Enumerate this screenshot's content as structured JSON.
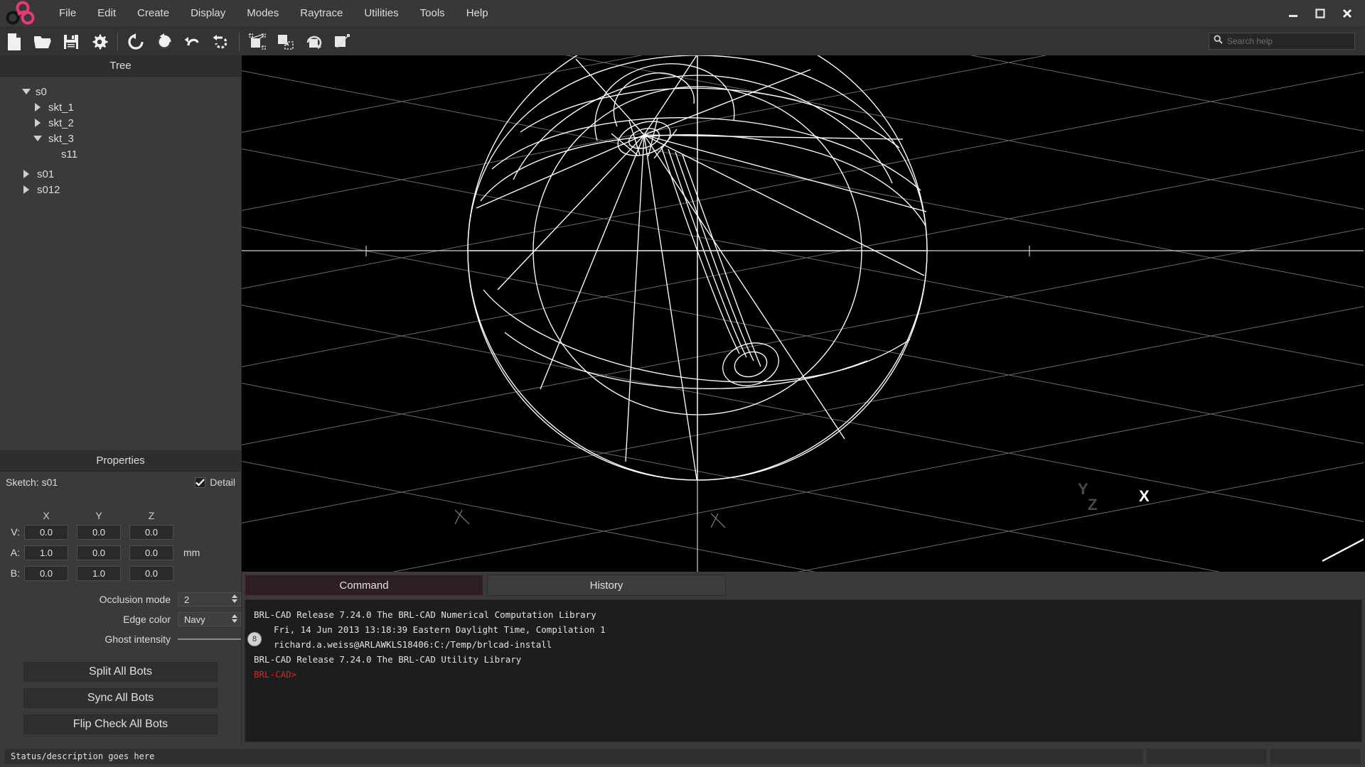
{
  "app": {
    "logo": "brlcad-logo"
  },
  "menubar": {
    "items": [
      {
        "label": "File"
      },
      {
        "label": "Edit"
      },
      {
        "label": "Create"
      },
      {
        "label": "Display"
      },
      {
        "label": "Modes"
      },
      {
        "label": "Raytrace"
      },
      {
        "label": "Utilities"
      },
      {
        "label": "Tools"
      },
      {
        "label": "Help"
      }
    ],
    "window_controls": [
      {
        "name": "minimize-button",
        "icon": "minimize-icon"
      },
      {
        "name": "maximize-button",
        "icon": "maximize-icon"
      },
      {
        "name": "close-button",
        "icon": "close-icon"
      }
    ]
  },
  "toolbar": {
    "buttons": [
      {
        "name": "new-file-button",
        "icon": "new-file-icon"
      },
      {
        "name": "open-file-button",
        "icon": "open-folder-icon"
      },
      {
        "name": "save-file-button",
        "icon": "save-disk-icon"
      },
      {
        "name": "preferences-button",
        "icon": "gear-icon"
      },
      {
        "name": "undo-all-button",
        "icon": "undo-circle-icon"
      },
      {
        "name": "redo-all-button",
        "icon": "redo-circle-icon"
      },
      {
        "name": "undo-button",
        "icon": "undo-arrow-icon"
      },
      {
        "name": "redo-button",
        "icon": "redo-dashed-icon"
      },
      {
        "name": "scale-tool-button",
        "icon": "scale-object-icon"
      },
      {
        "name": "translate-tool-button",
        "icon": "translate-object-icon"
      },
      {
        "name": "rotate-tool-button",
        "icon": "rotate-object-icon"
      },
      {
        "name": "shear-tool-button",
        "icon": "shear-object-icon"
      }
    ]
  },
  "search": {
    "placeholder": "Search help",
    "value": "",
    "icon": "search-icon"
  },
  "tree_panel": {
    "title": "Tree",
    "nodes": [
      {
        "label": "s0",
        "depth": 0,
        "state": "expanded"
      },
      {
        "label": "skt_1",
        "depth": 1,
        "state": "collapsed"
      },
      {
        "label": "skt_2",
        "depth": 1,
        "state": "collapsed"
      },
      {
        "label": "skt_3",
        "depth": 1,
        "state": "expanded"
      },
      {
        "label": "s11",
        "depth": 2,
        "state": "leaf"
      },
      {
        "label": "s01",
        "depth": 0,
        "state": "collapsed"
      },
      {
        "label": "s012",
        "depth": 0,
        "state": "collapsed"
      }
    ]
  },
  "properties_panel": {
    "title": "Properties",
    "sketch_label": "Sketch: s01",
    "detail_label": "Detail",
    "detail_checked": true,
    "axis_headers": [
      "X",
      "Y",
      "Z"
    ],
    "rows": [
      {
        "label": "V:",
        "values": [
          "0.0",
          "0.0",
          "0.0"
        ],
        "unit": ""
      },
      {
        "label": "A:",
        "values": [
          "1.0",
          "0.0",
          "0.0"
        ],
        "unit": "mm"
      },
      {
        "label": "B:",
        "values": [
          "0.0",
          "1.0",
          "0.0"
        ],
        "unit": ""
      }
    ],
    "occlusion_mode": {
      "label": "Occlusion mode",
      "value": "2"
    },
    "edge_color": {
      "label": "Edge color",
      "value": "Navy"
    },
    "ghost_intensity": {
      "label": "Ghost intensity",
      "value": "8",
      "min": 0,
      "max": 10
    },
    "buttons": [
      {
        "label": "Split All Bots"
      },
      {
        "label": "Sync All Bots"
      },
      {
        "label": "Flip Check All Bots"
      }
    ]
  },
  "viewport": {
    "background": "#000000",
    "wireframe_color": "#ffffff",
    "grid_color": "#6b6b6b",
    "axis_labels": [
      {
        "label": "X",
        "bright": true
      },
      {
        "label": "Y",
        "bright": false
      },
      {
        "label": "Z",
        "bright": false
      }
    ]
  },
  "console_panel": {
    "tabs": [
      {
        "label": "Command",
        "active": true
      },
      {
        "label": "History",
        "active": false
      }
    ],
    "lines": [
      {
        "text": "BRL-CAD Release 7.24.0  The BRL-CAD Numerical Computation Library",
        "type": "normal",
        "indent": 0
      },
      {
        "text": "Fri, 14 Jun 2013 13:18:39 Eastern Daylight Time, Compilation 1",
        "type": "normal",
        "indent": 1
      },
      {
        "text": "richard.a.weiss@ARLAWKLS18406:C:/Temp/brlcad-install",
        "type": "normal",
        "indent": 1
      },
      {
        "text": "BRL-CAD Release 7.24.0  The BRL-CAD Utility Library",
        "type": "normal",
        "indent": 0
      },
      {
        "text": "BRL-CAD>",
        "type": "prompt",
        "indent": 0
      }
    ]
  },
  "statusbar": {
    "message": "Status/description goes here",
    "box1": "",
    "box2": ""
  },
  "colors": {
    "accent_pink": "#e8387c",
    "active_tab": "#2e1f23",
    "prompt_red": "#e02020",
    "window_bg": "#3a3a3a",
    "panel_header": "#2e2e2e"
  }
}
